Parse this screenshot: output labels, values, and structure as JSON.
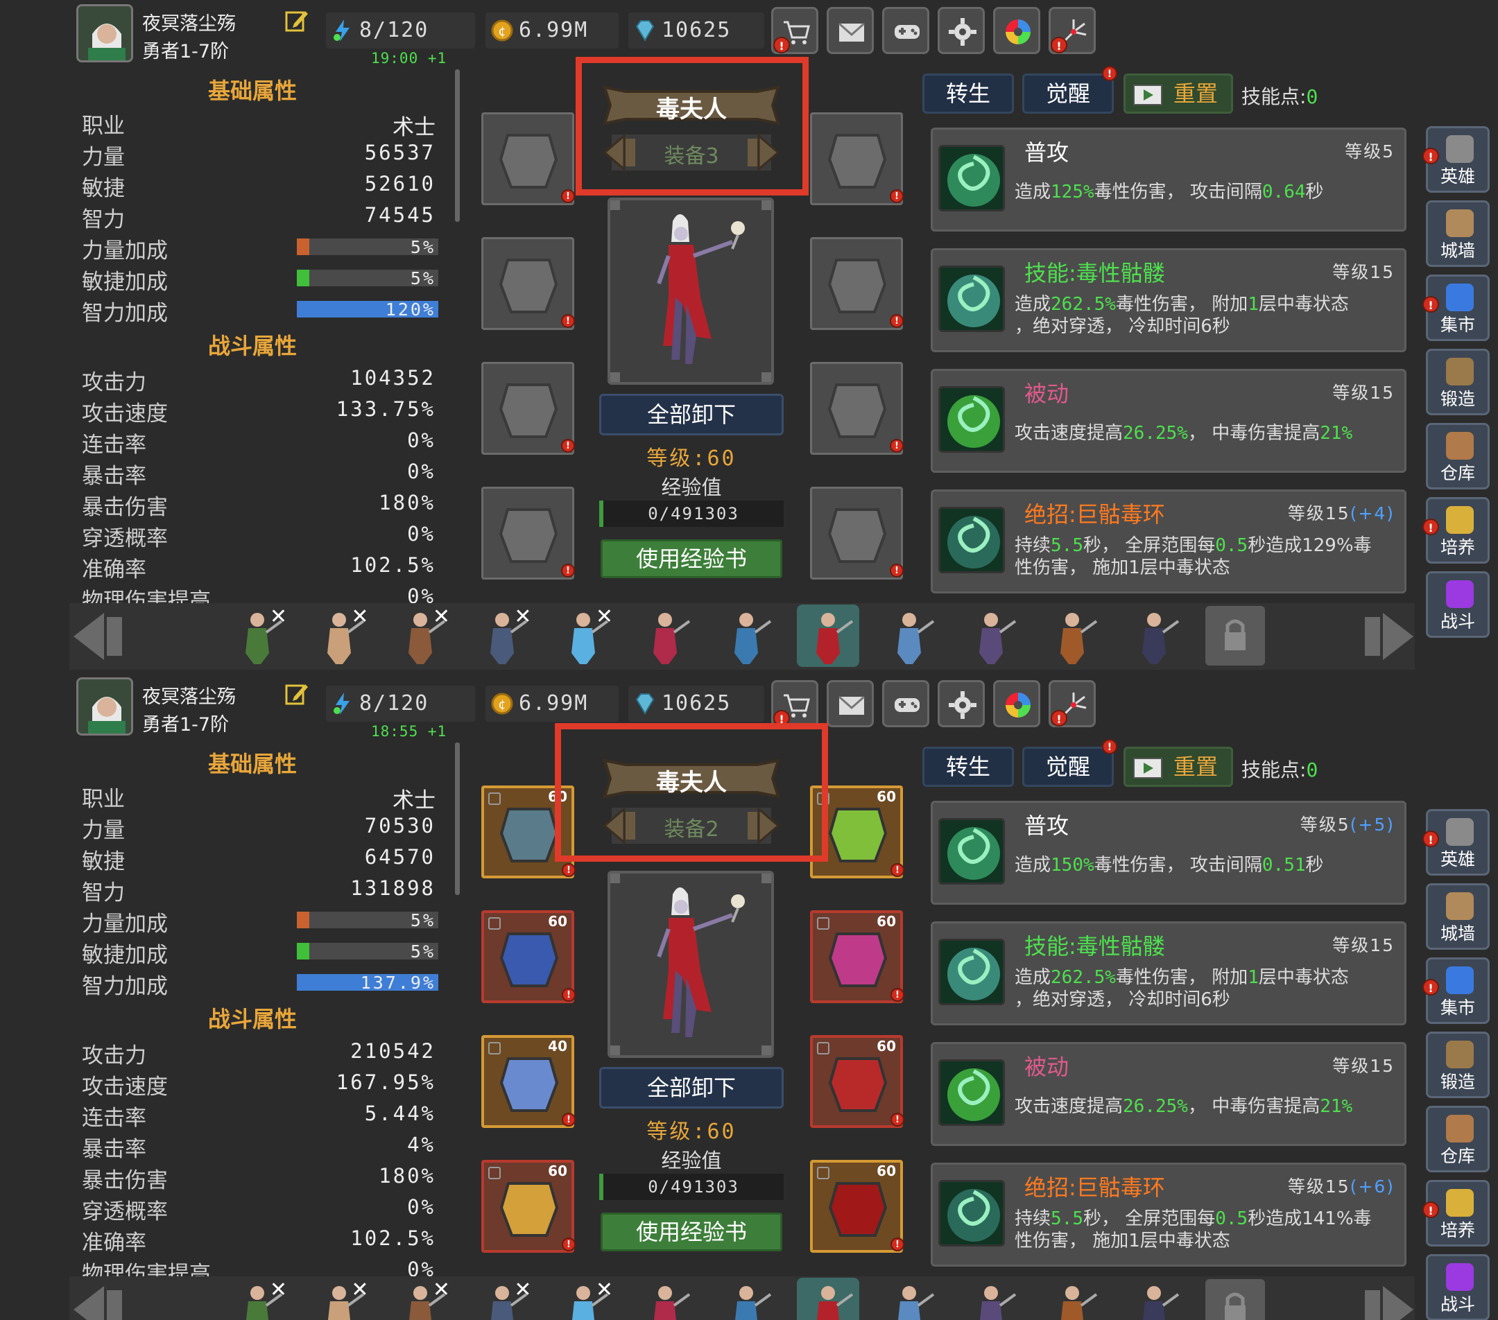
{
  "panels": [
    {
      "player_name": "夜冥落尘殇",
      "rank": "勇者1-7阶",
      "stamina": "8/120",
      "gold": "6.99M",
      "gems": "10625",
      "timer": "19:00 +1",
      "sections": {
        "basic": "基础属性",
        "combat": "战斗属性"
      },
      "basic_stats": [
        {
          "label": "职业",
          "value": "术士"
        },
        {
          "label": "力量",
          "value": "56537"
        },
        {
          "label": "敏捷",
          "value": "52610"
        },
        {
          "label": "智力",
          "value": "74545"
        }
      ],
      "bonus_stats": [
        {
          "label": "力量加成",
          "value": "5%",
          "fill": 0.05,
          "color": "#c9622e"
        },
        {
          "label": "敏捷加成",
          "value": "5%",
          "fill": 0.05,
          "color": "#3fbf3a"
        },
        {
          "label": "智力加成",
          "value": "120%",
          "fill": 1.0,
          "color": "#3f7ed6"
        }
      ],
      "combat_stats": [
        {
          "label": "攻击力",
          "value": "104352"
        },
        {
          "label": "攻击速度",
          "value": "133.75%"
        },
        {
          "label": "连击率",
          "value": "0%"
        },
        {
          "label": "暴击率",
          "value": "0%"
        },
        {
          "label": "暴击伤害",
          "value": "180%"
        },
        {
          "label": "穿透概率",
          "value": "0%"
        },
        {
          "label": "准确率",
          "value": "102.5%"
        },
        {
          "label": "物理伤害提高",
          "value": "0%"
        }
      ],
      "hero_name": "毒夫人",
      "equip_set": "装备3",
      "unequip_label": "全部卸下",
      "level_label": "等级:60",
      "exp_label": "经验值",
      "exp_value": "0/491303",
      "use_book_label": "使用经验书",
      "equip_slots": [
        {
          "name": "helmet",
          "empty": true
        },
        {
          "name": "necklace",
          "empty": true
        },
        {
          "name": "armor",
          "empty": true
        },
        {
          "name": "gloves",
          "empty": true
        },
        {
          "name": "pants",
          "empty": true
        },
        {
          "name": "ring",
          "empty": true
        },
        {
          "name": "boots",
          "empty": true
        },
        {
          "name": "weapon",
          "empty": true
        }
      ],
      "tabs": {
        "rebirth": "转生",
        "awaken": "觉醒",
        "reset": "重置",
        "skill_points_label": "技能点:",
        "skill_points": "0"
      },
      "skills": [
        {
          "name": "普攻",
          "name_color": "white",
          "level": "等级5",
          "level_bonus": "",
          "desc_parts": [
            "造成",
            "125%",
            "毒性伤害， 攻击间隔",
            "0.64",
            "秒"
          ],
          "desc2": ""
        },
        {
          "name": "技能:毒性骷髅",
          "name_color": "green",
          "level": "等级15",
          "level_bonus": "",
          "desc_parts": [
            "造成",
            "262.5%",
            "毒性伤害， 附加",
            "1",
            "层中毒状态"
          ],
          "desc2": "，绝对穿透， 冷却时间6秒"
        },
        {
          "name": "被动",
          "name_color": "pink",
          "level": "等级15",
          "level_bonus": "",
          "desc_parts": [
            "攻击速度提高",
            "26.25%",
            "， 中毒伤害提高",
            "21%",
            ""
          ],
          "desc2": ""
        },
        {
          "name": "绝招:巨骷毒环",
          "name_color": "orange",
          "level": "等级15",
          "level_bonus": "(+4)",
          "desc_parts": [
            "持续",
            "5.5",
            "秒， 全屏范围每",
            "0.5",
            "秒造成129%毒"
          ],
          "desc2": "性伤害， 施加1层中毒状态"
        }
      ]
    },
    {
      "player_name": "夜冥落尘殇",
      "rank": "勇者1-7阶",
      "stamina": "8/120",
      "gold": "6.99M",
      "gems": "10625",
      "timer": "18:55 +1",
      "sections": {
        "basic": "基础属性",
        "combat": "战斗属性"
      },
      "basic_stats": [
        {
          "label": "职业",
          "value": "术士"
        },
        {
          "label": "力量",
          "value": "70530"
        },
        {
          "label": "敏捷",
          "value": "64570"
        },
        {
          "label": "智力",
          "value": "131898"
        }
      ],
      "bonus_stats": [
        {
          "label": "力量加成",
          "value": "5%",
          "fill": 0.05,
          "color": "#c9622e"
        },
        {
          "label": "敏捷加成",
          "value": "5%",
          "fill": 0.05,
          "color": "#3fbf3a"
        },
        {
          "label": "智力加成",
          "value": "137.9%",
          "fill": 1.0,
          "color": "#3f7ed6"
        }
      ],
      "combat_stats": [
        {
          "label": "攻击力",
          "value": "210542"
        },
        {
          "label": "攻击速度",
          "value": "167.95%"
        },
        {
          "label": "连击率",
          "value": "5.44%"
        },
        {
          "label": "暴击率",
          "value": "4%"
        },
        {
          "label": "暴击伤害",
          "value": "180%"
        },
        {
          "label": "穿透概率",
          "value": "0%"
        },
        {
          "label": "准确率",
          "value": "102.5%"
        },
        {
          "label": "物理伤害提高",
          "value": "0%"
        }
      ],
      "hero_name": "毒夫人",
      "equip_set": "装备2",
      "unequip_label": "全部卸下",
      "level_label": "等级:60",
      "exp_label": "经验值",
      "exp_value": "0/491303",
      "use_book_label": "使用经验书",
      "equip_slots": [
        {
          "name": "helmet",
          "level": "60",
          "tier": "orange"
        },
        {
          "name": "necklace",
          "level": "60",
          "tier": "orange"
        },
        {
          "name": "armor",
          "level": "60",
          "tier": "red"
        },
        {
          "name": "gloves",
          "level": "60",
          "tier": "red"
        },
        {
          "name": "pants",
          "level": "40",
          "tier": "orange"
        },
        {
          "name": "ring",
          "level": "60",
          "tier": "red"
        },
        {
          "name": "boots",
          "level": "60",
          "tier": "red"
        },
        {
          "name": "weapon",
          "level": "60",
          "tier": "orange"
        }
      ],
      "tabs": {
        "rebirth": "转生",
        "awaken": "觉醒",
        "reset": "重置",
        "skill_points_label": "技能点:",
        "skill_points": "0"
      },
      "skills": [
        {
          "name": "普攻",
          "name_color": "white",
          "level": "等级5",
          "level_bonus": "(+5)",
          "desc_parts": [
            "造成",
            "150%",
            "毒性伤害， 攻击间隔",
            "0.51",
            "秒"
          ],
          "desc2": ""
        },
        {
          "name": "技能:毒性骷髅",
          "name_color": "green",
          "level": "等级15",
          "level_bonus": "",
          "desc_parts": [
            "造成",
            "262.5%",
            "毒性伤害， 附加",
            "1",
            "层中毒状态"
          ],
          "desc2": "，绝对穿透， 冷却时间6秒"
        },
        {
          "name": "被动",
          "name_color": "pink",
          "level": "等级15",
          "level_bonus": "",
          "desc_parts": [
            "攻击速度提高",
            "26.25%",
            "， 中毒伤害提高",
            "21%",
            ""
          ],
          "desc2": ""
        },
        {
          "name": "绝招:巨骷毒环",
          "name_color": "orange",
          "level": "等级15",
          "level_bonus": "(+6)",
          "desc_parts": [
            "持续",
            "5.5",
            "秒， 全屏范围每",
            "0.5",
            "秒造成141%毒"
          ],
          "desc2": "性伤害， 施加1层中毒状态"
        }
      ]
    }
  ],
  "side_menu": [
    "英雄",
    "城墙",
    "集市",
    "锻造",
    "仓库",
    "培养",
    "战斗"
  ],
  "toolbar_icons": [
    "cart-icon",
    "mail-icon",
    "gamepad-icon",
    "gear-icon",
    "color-wheel-icon",
    "fireworks-icon"
  ],
  "heroes": [
    {
      "name": "archer",
      "locked": true
    },
    {
      "name": "dancer",
      "locked": true
    },
    {
      "name": "barbarian",
      "locked": true
    },
    {
      "name": "knight",
      "locked": true
    },
    {
      "name": "ice-mage",
      "locked": true
    },
    {
      "name": "priestess",
      "locked": false
    },
    {
      "name": "gunner",
      "locked": false
    },
    {
      "name": "poison-lady",
      "locked": false,
      "selected": true
    },
    {
      "name": "spirit",
      "locked": false
    },
    {
      "name": "wizard",
      "locked": false
    },
    {
      "name": "beast",
      "locked": false
    },
    {
      "name": "assassin",
      "locked": false
    },
    {
      "name": "locked-slot",
      "locked": false
    }
  ],
  "alert_mark": "!"
}
